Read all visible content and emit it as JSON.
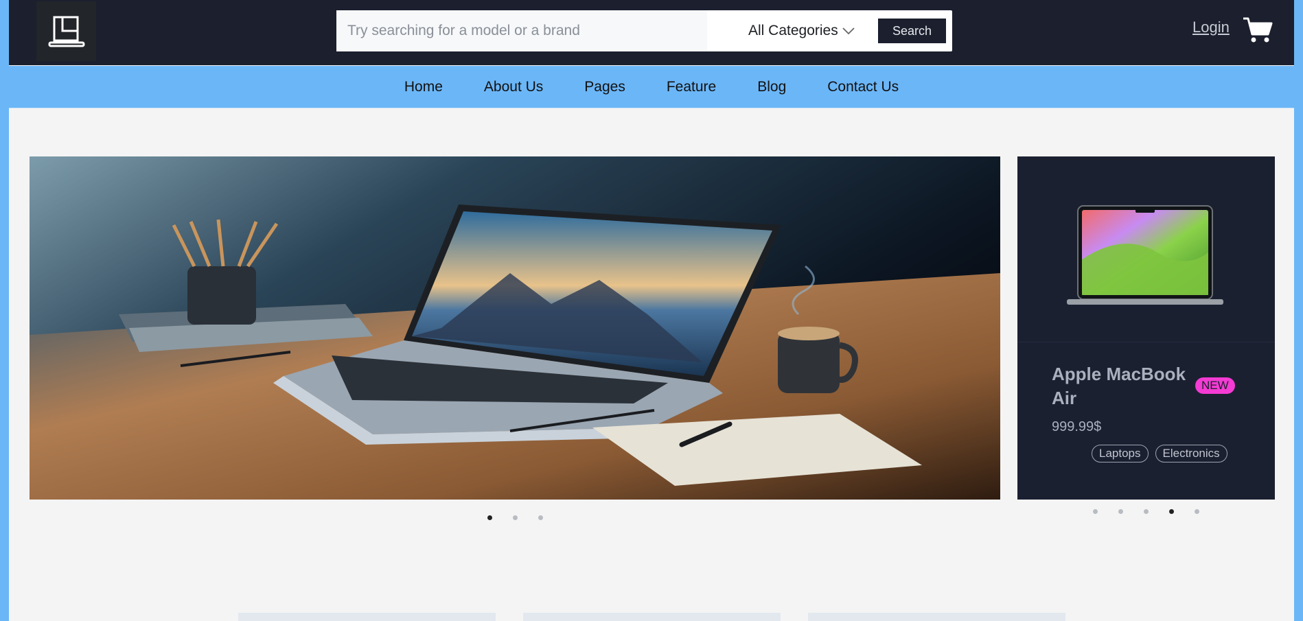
{
  "header": {
    "search_placeholder": "Try searching for a model or a brand",
    "category_label": "All Categories",
    "search_button": "Search",
    "login_label": "Login",
    "logo_icon": "laptop-logo-icon",
    "cart_icon": "cart-icon"
  },
  "nav": {
    "items": [
      "Home",
      "About Us",
      "Pages",
      "Feature",
      "Blog",
      "Contact Us"
    ]
  },
  "hero": {
    "slide_count": 3,
    "active_slide": 1
  },
  "product_card": {
    "title": "Apple MacBook Air",
    "badge": "NEW",
    "price": "999.99$",
    "tags": [
      "Laptops",
      "Electronics"
    ],
    "slide_count": 5,
    "active_slide": 4
  },
  "colors": {
    "topbar": "#1b1f2e",
    "navbar": "#6bb6f7",
    "badge": "#f43bd3",
    "page_bg": "#f4f4f4"
  }
}
